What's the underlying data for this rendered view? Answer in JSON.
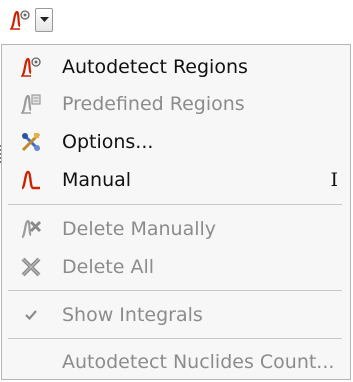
{
  "menu": {
    "items": [
      {
        "label": "Autodetect Regions",
        "icon": "autodetect-regions-icon",
        "enabled": true
      },
      {
        "label": "Predefined Regions",
        "icon": "predefined-regions-icon",
        "enabled": false
      },
      {
        "label": "Options...",
        "icon": "options-icon",
        "enabled": true
      },
      {
        "label": "Manual",
        "icon": "manual-icon",
        "enabled": true,
        "shortcut": "I"
      },
      {
        "label": "Delete Manually",
        "icon": "delete-manually-icon",
        "enabled": false
      },
      {
        "label": "Delete All",
        "icon": "delete-all-icon",
        "enabled": false
      },
      {
        "label": "Show Integrals",
        "icon": "checkmark-icon",
        "enabled": false,
        "checked": true
      },
      {
        "label": "Autodetect Nuclides Count...",
        "icon": "",
        "enabled": false
      }
    ]
  },
  "colors": {
    "integral_red": "#cc2200",
    "disabled_text": "#8c8c8c",
    "menu_bg": "#f7f7f7"
  }
}
